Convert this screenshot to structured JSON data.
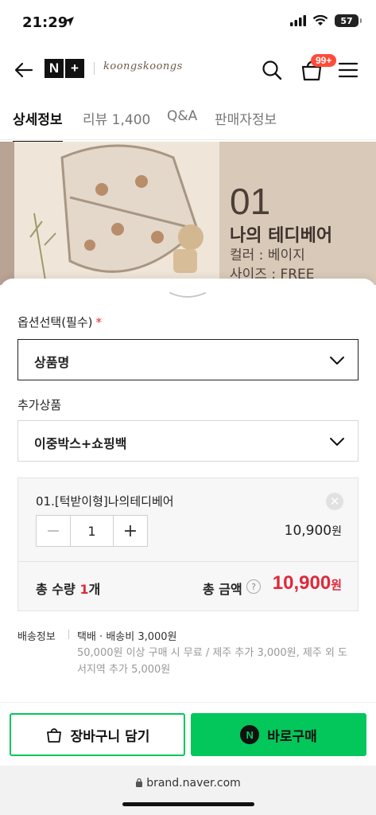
{
  "status": {
    "time": "21:29",
    "battery": "57"
  },
  "header": {
    "logo_n": "N",
    "logo_plus": "+",
    "brand": "koongskoongs",
    "cart_badge": "99+"
  },
  "tabs": [
    {
      "label": "상세정보",
      "active": true
    },
    {
      "label": "리뷰 1,400",
      "active": false
    },
    {
      "label": "Q&A",
      "active": false
    },
    {
      "label": "판매자정보",
      "active": false
    }
  ],
  "product_image": {
    "number": "01",
    "name": "나의 테디베어",
    "color": "컬러 : 베이지",
    "size": "사이즈 : FREE"
  },
  "options": {
    "label": "옵션선택(필수)",
    "required_mark": "*",
    "selected": "상품명",
    "addon_label": "추가상품",
    "addon_selected": "이중박스+쇼핑백"
  },
  "selected_item": {
    "name": "01.[턱받이형]나의테디베어",
    "quantity": "1",
    "price": "10,900",
    "currency": "원"
  },
  "totals": {
    "qty_prefix": "총 수량 ",
    "qty": "1",
    "qty_suffix": "개",
    "amount_label": "총 금액",
    "amount": "10,900",
    "currency": "원"
  },
  "shipping": {
    "label": "배송정보",
    "main": "택배 · 배송비 3,000원",
    "sub": "50,000원 이상 구매 시 무료 / 제주 추가 3,000원, 제주 외 도서지역 추가 5,000원"
  },
  "actions": {
    "cart": "장바구니 담기",
    "buy": "바로구매",
    "buy_icon": "N"
  },
  "browser": {
    "url": "brand.naver.com"
  },
  "colors": {
    "naver_green": "#03c75a",
    "price_red": "#e0283a",
    "badge": "#ff4b3a"
  }
}
